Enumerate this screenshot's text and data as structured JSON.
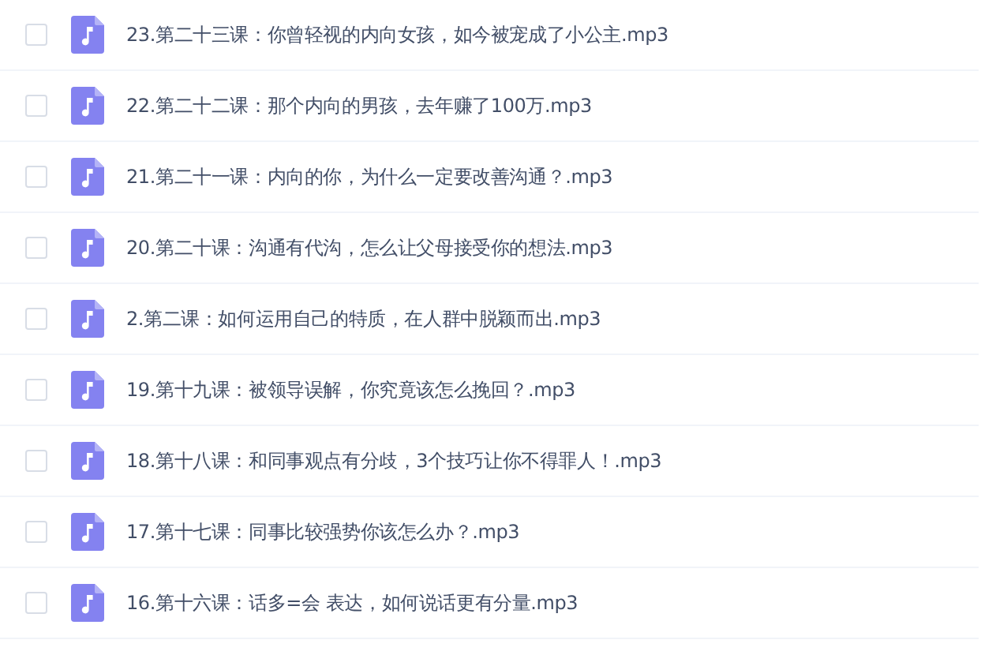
{
  "files": [
    {
      "name": "23.第二十三课：你曾轻视的内向女孩，如今被宠成了小公主.mp3",
      "checked": false
    },
    {
      "name": "22.第二十二课：那个内向的男孩，去年赚了100万.mp3",
      "checked": false
    },
    {
      "name": "21.第二十一课：内向的你，为什么一定要改善沟通？.mp3",
      "checked": false
    },
    {
      "name": "20.第二十课：沟通有代沟，怎么让父母接受你的想法.mp3",
      "checked": false
    },
    {
      "name": "2.第二课：如何运用自己的特质，在人群中脱颖而出.mp3",
      "checked": false
    },
    {
      "name": "19.第十九课：被领导误解，你究竟该怎么挽回？.mp3",
      "checked": false
    },
    {
      "name": "18.第十八课：和同事观点有分歧，3个技巧让你不得罪人！.mp3",
      "checked": false
    },
    {
      "name": "17.第十七课：同事比较强势你该怎么办？.mp3",
      "checked": false
    },
    {
      "name": "16.第十六课：话多=会 表达，如何说话更有分量.mp3",
      "checked": false
    }
  ]
}
